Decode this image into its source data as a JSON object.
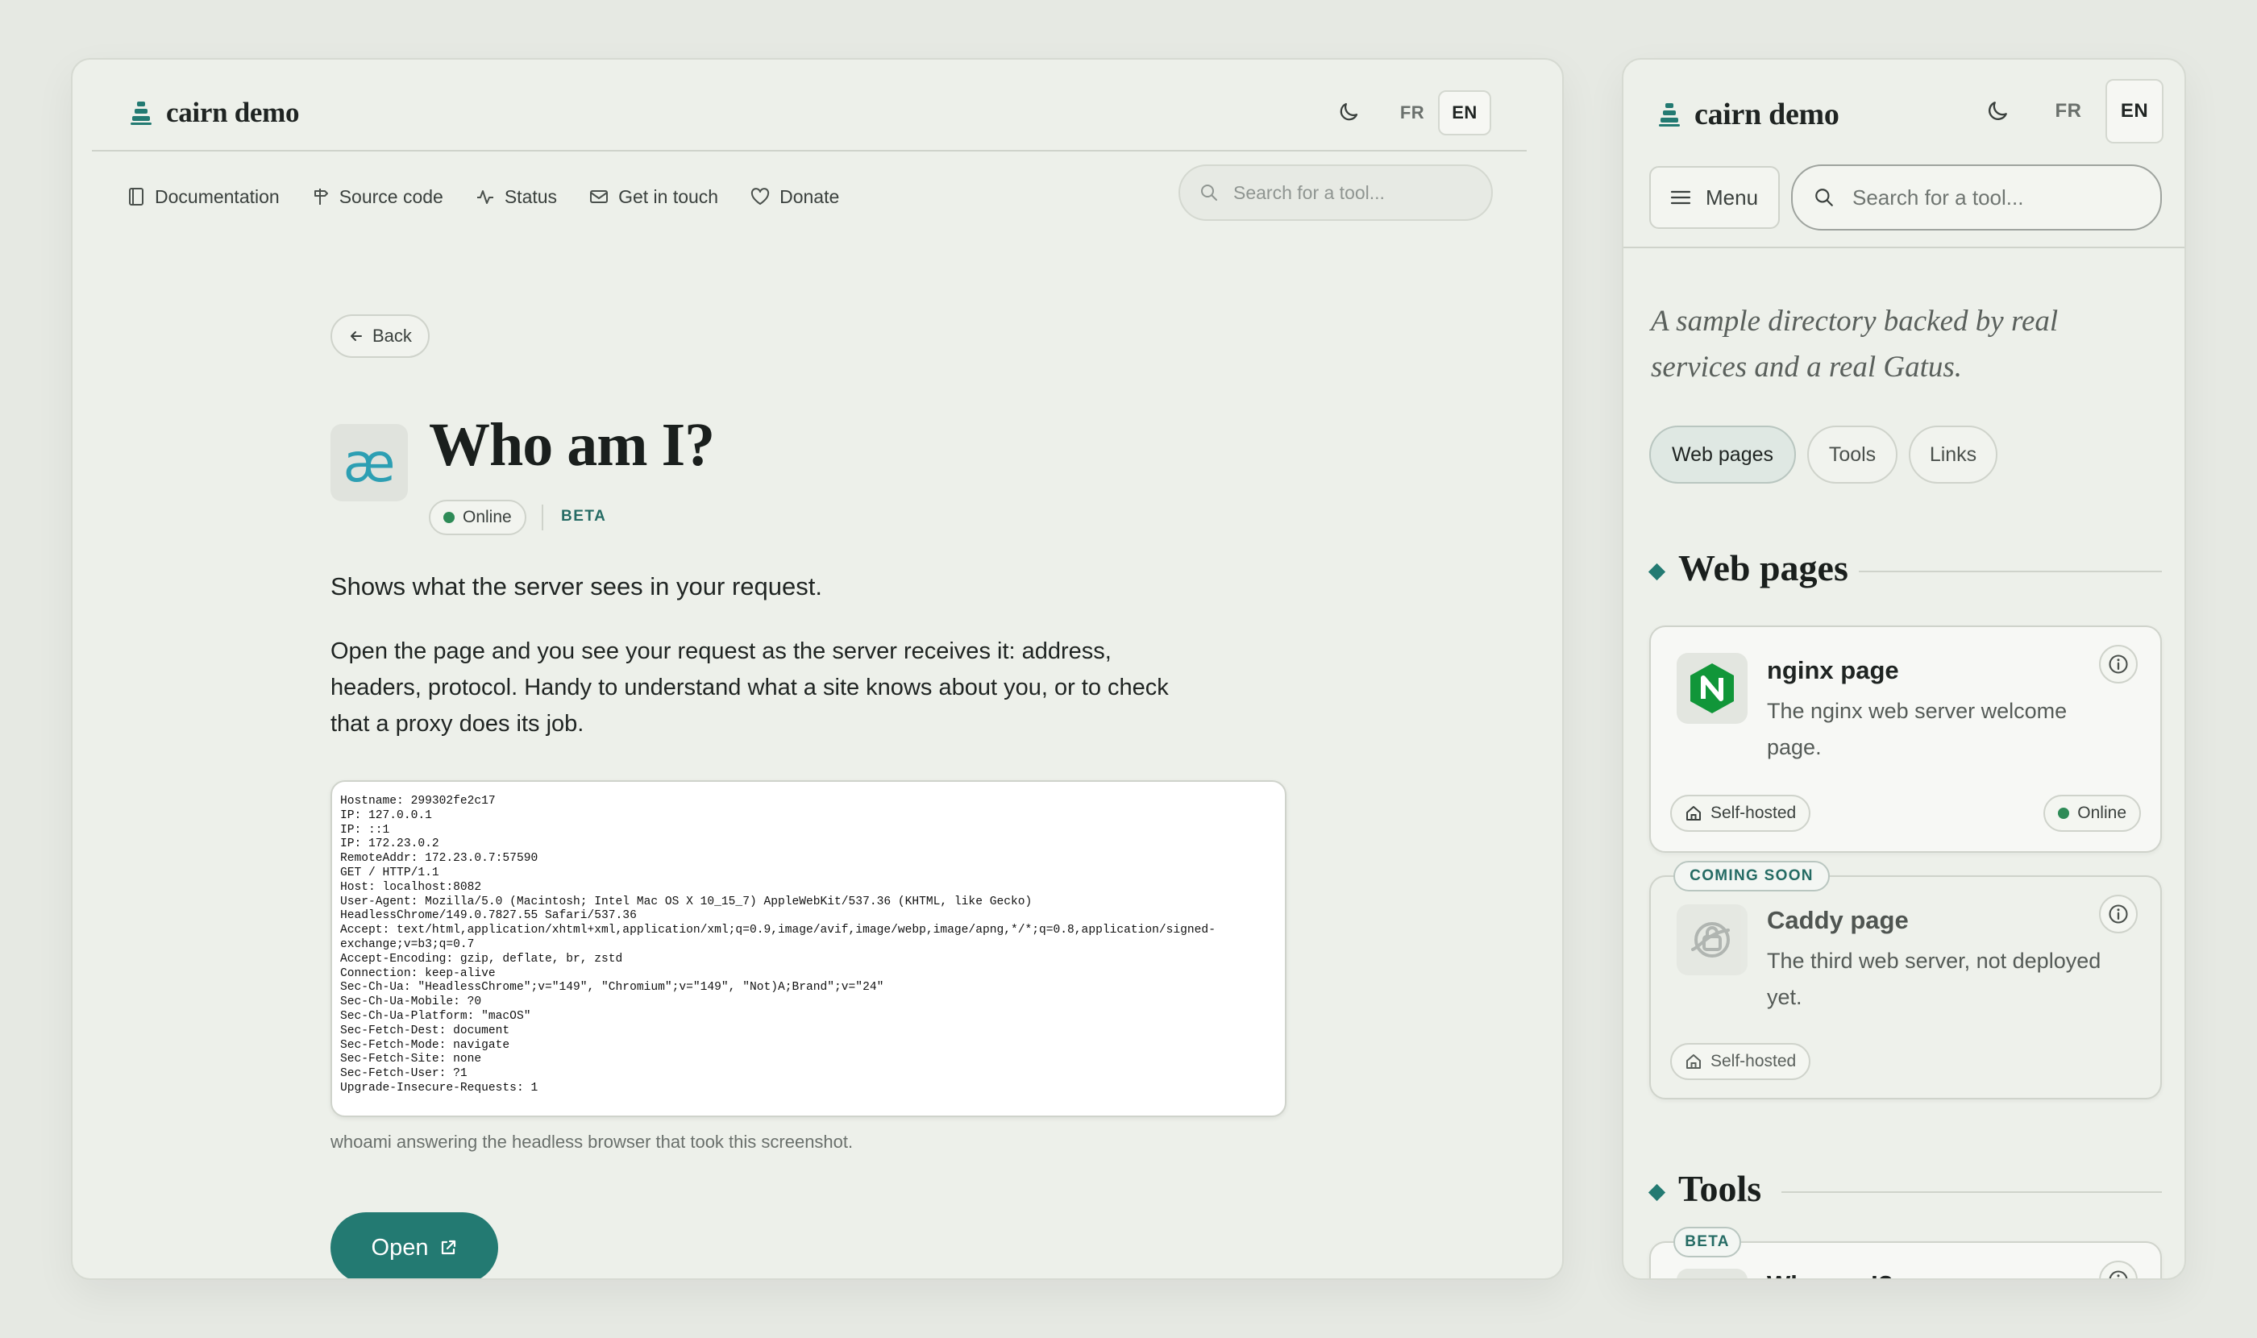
{
  "desktop": {
    "brand": {
      "name": "cairn demo"
    },
    "header": {
      "lang_fr": "FR",
      "lang_en": "EN"
    },
    "nav": {
      "items": [
        {
          "label": "Documentation",
          "icon": "book-icon"
        },
        {
          "label": "Source code",
          "icon": "signpost-icon"
        },
        {
          "label": "Status",
          "icon": "activity-icon"
        },
        {
          "label": "Get in touch",
          "icon": "mail-icon"
        },
        {
          "label": "Donate",
          "icon": "heart-icon"
        }
      ],
      "search_placeholder": "Search for a tool..."
    },
    "back_label": "Back",
    "tool": {
      "icon_glyph": "æ",
      "title": "Who am I?",
      "status": "Online",
      "badge": "BETA",
      "summary": "Shows what the server sees in your request.",
      "description": "Open the page and you see your request as the server receives it: address, headers, protocol. Handy to understand what a site knows about you, or to check that a proxy does its job.",
      "output_lines": [
        "Hostname: 299302fe2c17",
        "IP: 127.0.0.1",
        "IP: ::1",
        "IP: 172.23.0.2",
        "RemoteAddr: 172.23.0.7:57590",
        "GET / HTTP/1.1",
        "Host: localhost:8082",
        "User-Agent: Mozilla/5.0 (Macintosh; Intel Mac OS X 10_15_7) AppleWebKit/537.36 (KHTML, like Gecko)",
        "HeadlessChrome/149.0.7827.55 Safari/537.36",
        "Accept: text/html,application/xhtml+xml,application/xml;q=0.9,image/avif,image/webp,image/apng,*/*;q=0.8,application/signed-",
        "exchange;v=b3;q=0.7",
        "Accept-Encoding: gzip, deflate, br, zstd",
        "Connection: keep-alive",
        "Sec-Ch-Ua: \"HeadlessChrome\";v=\"149\", \"Chromium\";v=\"149\", \"Not)A;Brand\";v=\"24\"",
        "Sec-Ch-Ua-Mobile: ?0",
        "Sec-Ch-Ua-Platform: \"macOS\"",
        "Sec-Fetch-Dest: document",
        "Sec-Fetch-Mode: navigate",
        "Sec-Fetch-Site: none",
        "Sec-Fetch-User: ?1",
        "Upgrade-Insecure-Requests: 1"
      ],
      "caption": "whoami answering the headless browser that took this screenshot.",
      "open_label": "Open"
    }
  },
  "mobile": {
    "brand": {
      "name": "cairn demo"
    },
    "header": {
      "lang_fr": "FR",
      "lang_en": "EN"
    },
    "menu_label": "Menu",
    "search_placeholder": "Search for a tool...",
    "tagline": "A sample directory backed by real services and a real Gatus.",
    "filters": [
      "Web pages",
      "Tools",
      "Links"
    ],
    "sections": {
      "web_pages": "Web pages",
      "tools": "Tools"
    },
    "cards": {
      "nginx": {
        "title": "nginx page",
        "description": "The nginx web server welcome page.",
        "tag": "Self-hosted",
        "status": "Online"
      },
      "caddy": {
        "badge": "COMING SOON",
        "title": "Caddy page",
        "description": "The third web server, not deployed yet.",
        "tag": "Self-hosted"
      },
      "whoami": {
        "badge": "BETA",
        "title": "Who am I?"
      }
    }
  },
  "colors": {
    "accent": "#237a72",
    "online": "#2e8b57",
    "background": "#edf0ea",
    "nginx_green": "#119639"
  }
}
